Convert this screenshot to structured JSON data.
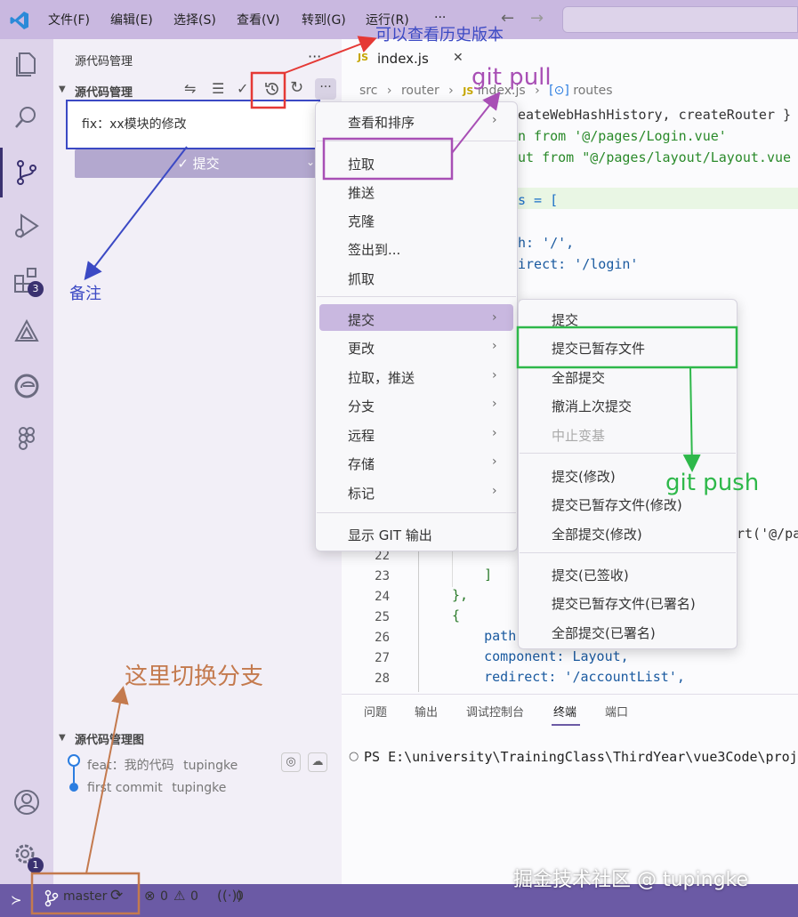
{
  "titlebar": {
    "menus": [
      "文件(F)",
      "编辑(E)",
      "选择(S)",
      "查看(V)",
      "转到(G)",
      "运行(R)",
      "···"
    ],
    "back": "←",
    "forward": "→"
  },
  "activitybar": {
    "extensions_badge": "3",
    "settings_badge": "1"
  },
  "sidebar": {
    "title": "源代码管理",
    "more": "···",
    "section_title": "源代码管理",
    "commit_message": "fix：xx模块的修改",
    "commit_button": "✓ 提交",
    "graph_title": "源代码管理图",
    "graph": [
      {
        "message": "feat：我的代码",
        "author": "tupingke"
      },
      {
        "message": "first commit",
        "author": "tupingke"
      }
    ]
  },
  "editor": {
    "tab_file": "index.js",
    "tab_close": "✕",
    "breadcrumb": [
      "src",
      "router",
      "index.js",
      "routes"
    ],
    "lines_top": [
      "eateWebHashHistory, createRouter }",
      "n from '@/pages/Login.vue'",
      "ut from \"@/pages/layout/Layout.vue",
      "",
      "s = [",
      "",
      "h: '/',",
      "irect: '/login'"
    ],
    "line_numbers": [
      "22",
      "23",
      "24",
      "25",
      "26",
      "27",
      "28"
    ],
    "lines_bottom": [
      "",
      "    ]",
      "},",
      "{",
      "    path",
      "    component: Layout,",
      "    redirect: '/accountList',"
    ],
    "fragment": "rt('@/pa"
  },
  "panel": {
    "tabs": [
      "问题",
      "输出",
      "调试控制台",
      "终端",
      "端口"
    ],
    "terminal": "PS E:\\university\\TrainingClass\\ThirdYear\\vue3Code\\proj"
  },
  "menu_main": {
    "items": [
      "查看和排序",
      "拉取",
      "推送",
      "克隆",
      "签出到...",
      "抓取",
      "提交",
      "更改",
      "拉取，推送",
      "分支",
      "远程",
      "存储",
      "标记",
      "显示 GIT 输出"
    ]
  },
  "menu_commit": {
    "items": [
      "提交",
      "提交已暂存文件",
      "全部提交",
      "撤消上次提交",
      "中止变基",
      "提交(修改)",
      "提交已暂存文件(修改)",
      "全部提交(修改)",
      "提交(已签收)",
      "提交已暂存文件(已署名)",
      "全部提交(已署名)"
    ]
  },
  "statusbar": {
    "branch": "master",
    "errors": "0",
    "warnings": "0",
    "ports": "0"
  },
  "annotations": {
    "history": "可以查看历史版本",
    "git_pull": "git pull",
    "note": "备注",
    "git_push": "git push",
    "switch_branch": "这里切换分支",
    "watermark": "掘金技术社区 @ tupingke"
  },
  "colors": {
    "accent": "#6b5aa5",
    "red": "#e53935",
    "purple": "#a84fb5",
    "blue": "#3b49c4",
    "green": "#2eb84a",
    "brown": "#c47a4e"
  }
}
